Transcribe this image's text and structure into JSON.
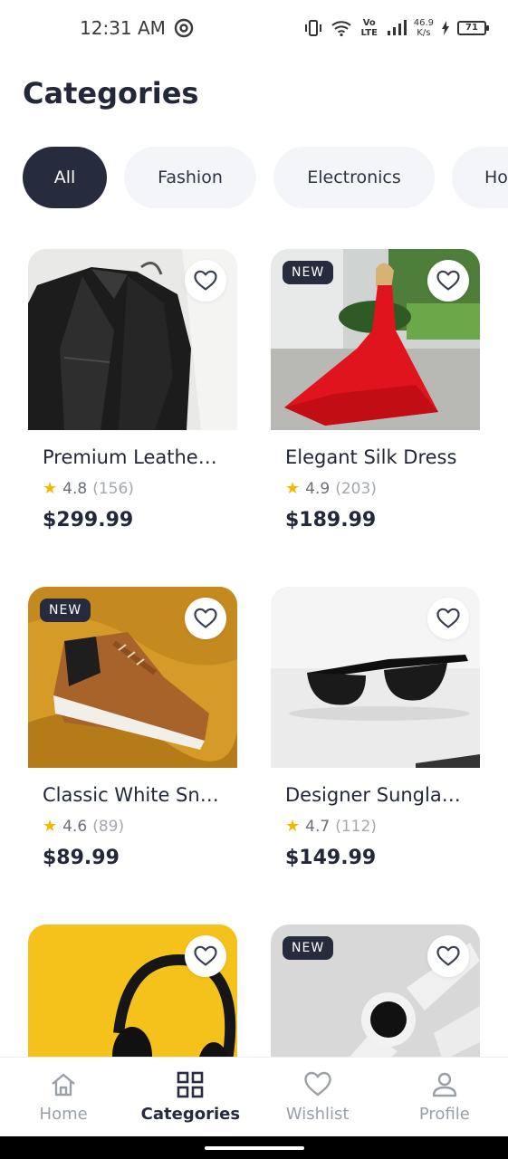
{
  "status_bar": {
    "time": "12:31 AM",
    "speed_value": "46.9",
    "speed_unit": "K/s",
    "network": "Vo LTE",
    "battery": "71"
  },
  "page": {
    "title": "Categories"
  },
  "chips": [
    "All",
    "Fashion",
    "Electronics",
    "Ho"
  ],
  "products": [
    {
      "name": "Premium Leather Jacket",
      "rating": "4.8",
      "reviews": "(156)",
      "price": "$299.99",
      "badge": ""
    },
    {
      "name": "Elegant Silk Dress",
      "rating": "4.9",
      "reviews": "(203)",
      "price": "$189.99",
      "badge": "NEW"
    },
    {
      "name": "Classic White Sneakers",
      "rating": "4.6",
      "reviews": "(89)",
      "price": "$89.99",
      "badge": "NEW"
    },
    {
      "name": "Designer Sunglasses",
      "rating": "4.7",
      "reviews": "(112)",
      "price": "$149.99",
      "badge": ""
    },
    {
      "name": "",
      "rating": "",
      "reviews": "",
      "price": "",
      "badge": ""
    },
    {
      "name": "",
      "rating": "",
      "reviews": "",
      "price": "",
      "badge": "NEW"
    }
  ],
  "nav": {
    "home": "Home",
    "categories": "Categories",
    "wishlist": "Wishlist",
    "profile": "Profile"
  },
  "icons": [
    "at-icon",
    "vibrate-icon",
    "wifi-icon",
    "signal-icon",
    "battery-icon",
    "heart-icon",
    "star-icon",
    "home-icon",
    "grid-icon",
    "profile-icon"
  ],
  "colors": {
    "accent": "#262c3d",
    "chip_bg": "#f3f5f8",
    "star": "#f5b800",
    "inactive": "#9aa0a8"
  }
}
